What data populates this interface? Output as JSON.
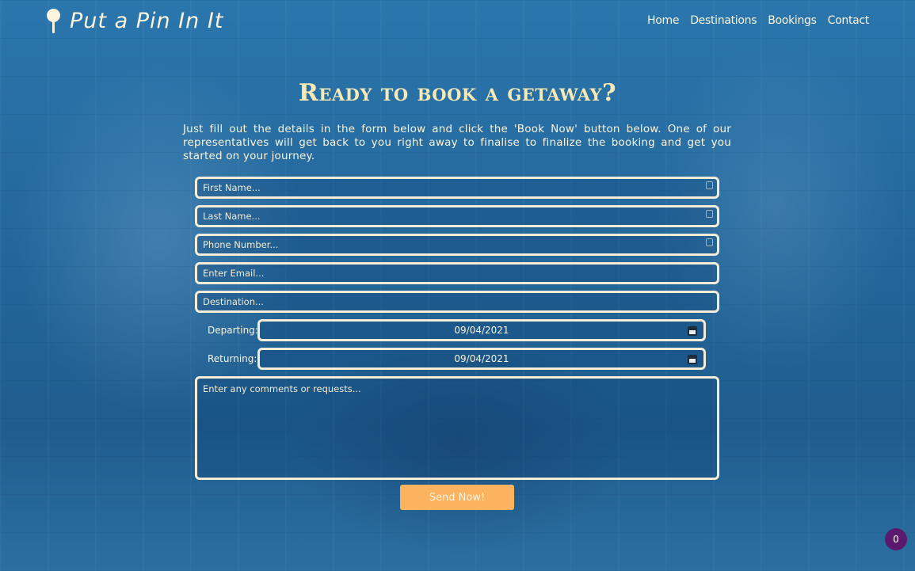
{
  "header": {
    "brand": "Put a Pin In It",
    "nav": [
      "Home",
      "Destinations",
      "Bookings",
      "Contact"
    ]
  },
  "main": {
    "heading": "Ready to book a getaway?",
    "intro": "Just fill out the details in the form below and click the 'Book Now' button below. One of our representatives will get back to you right away to finalise to finalize the booking and get you started on your journey."
  },
  "form": {
    "first_name_placeholder": "First Name...",
    "last_name_placeholder": "Last Name...",
    "phone_placeholder": "Phone Number...",
    "email_placeholder": "Enter Email...",
    "destination_placeholder": "Destination...",
    "departing_label": "Departing:",
    "departing_value": "09/04/2021",
    "returning_label": "Returning:",
    "returning_value": "09/04/2021",
    "comments_placeholder": "Enter any comments or requests...",
    "submit_label": "Send Now!"
  },
  "widget": {
    "count": "0"
  }
}
